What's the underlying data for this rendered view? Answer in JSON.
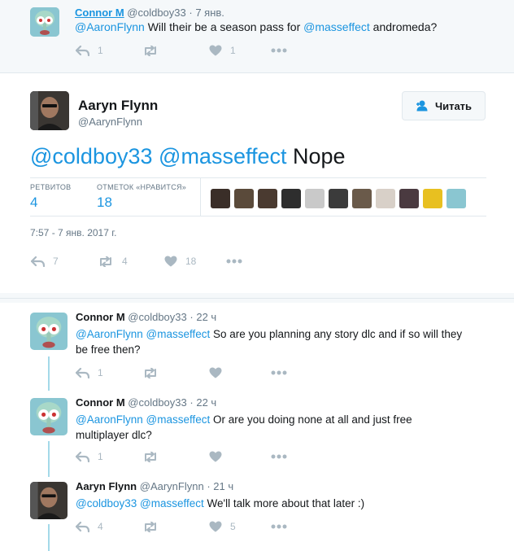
{
  "ancestor": {
    "name": "Connor M",
    "handle": "@coldboy33",
    "dot": "·",
    "time": "7 янв.",
    "text_mention1": "@AaronFlynn",
    "text_middle": " Will their be a season pass for ",
    "text_mention2": "@masseffect",
    "text_end": " andromeda?",
    "reply_count": "1",
    "retweet_count": "",
    "like_count": "1"
  },
  "main": {
    "name": "Aaryn Flynn",
    "handle": "@AarynFlynn",
    "follow_label": "Читать",
    "mention1": "@coldboy33",
    "mention2": "@masseffect",
    "text_end": " Nope",
    "retweets_label": "РЕТВИТОВ",
    "retweets_value": "4",
    "likes_label": "ОТМЕТОК «НРАВИТСЯ»",
    "likes_value": "18",
    "date": "7:57 - 7 янв. 2017 г.",
    "reply_count": "7",
    "retweet_count": "4",
    "like_count": "18",
    "likers_colors": [
      "#3a2e28",
      "#5a4a3a",
      "#4a3a30",
      "#2e2e2e",
      "#c9c9c9",
      "#3b3b3b",
      "#6a5a4a",
      "#d8d0c8",
      "#4a3a40",
      "#e8c020",
      "#8ac6d1"
    ]
  },
  "replies": [
    {
      "name": "Connor M",
      "handle": "@coldboy33",
      "dot": "·",
      "time": "22 ч",
      "mention1": "@AaronFlynn",
      "mention2": "@masseffect",
      "text_end": " So are you planning any story dlc and if so will they",
      "text_line2": "be free then?",
      "reply_count": "1",
      "retweet_count": "",
      "like_count": ""
    },
    {
      "name": "Connor M",
      "handle": "@coldboy33",
      "dot": "·",
      "time": "22 ч",
      "mention1": "@AaronFlynn",
      "mention2": "@masseffect",
      "text_end": " Or are you doing none at all and just free",
      "text_line2": "multiplayer dlc?",
      "reply_count": "1",
      "retweet_count": "",
      "like_count": ""
    },
    {
      "name": "Aaryn Flynn",
      "handle": "@AarynFlynn",
      "dot": "·",
      "time": "21 ч",
      "mention1": "@coldboy33",
      "mention2": "@masseffect",
      "text_end": " We'll talk more about that later :)",
      "text_line2": "",
      "reply_count": "4",
      "retweet_count": "",
      "like_count": "5"
    }
  ],
  "colors": {
    "link": "#1b95e0",
    "icon_gray": "#aab8c2",
    "thread_line": "#a4d9e9"
  }
}
